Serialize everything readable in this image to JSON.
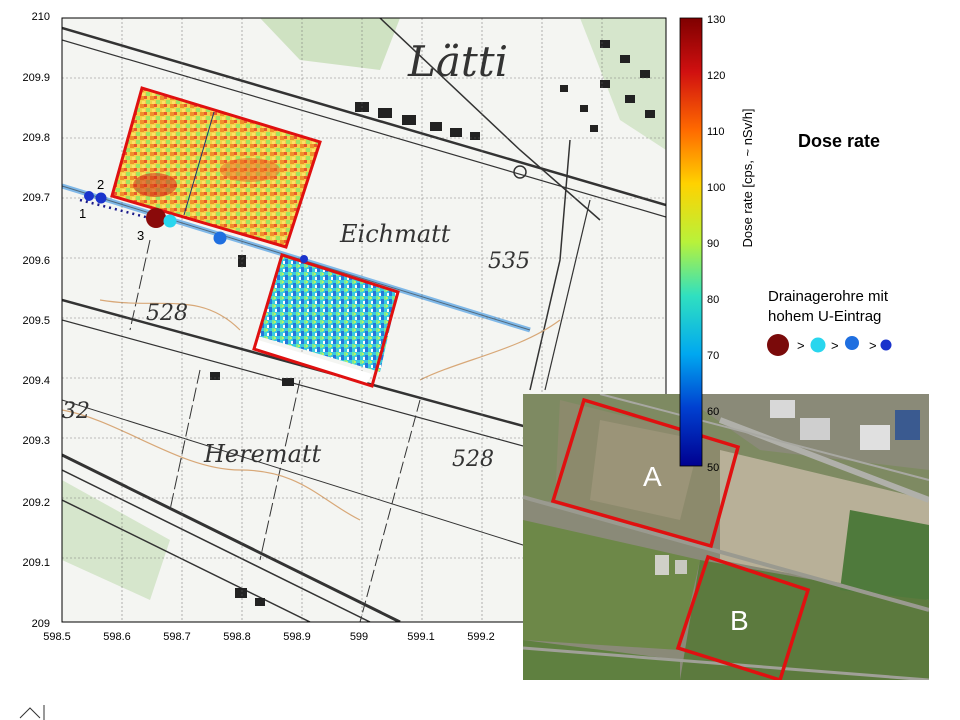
{
  "title": "Dose rate",
  "colorbar": {
    "label": "Dose rate [cps, ~ nSv/h]",
    "ticks": [
      "130",
      "120",
      "110",
      "100",
      "90",
      "80",
      "70",
      "60",
      "50"
    ]
  },
  "axes": {
    "y_ticks": [
      "210",
      "209.9",
      "209.8",
      "209.7",
      "209.6",
      "209.5",
      "209.4",
      "209.3",
      "209.2",
      "209.1",
      "209"
    ],
    "x_ticks": [
      "598.5",
      "598.6",
      "598.7",
      "598.8",
      "598.9",
      "599",
      "599.1",
      "599.2"
    ]
  },
  "map_labels": {
    "latti": "Lätti",
    "eichmatt": "Eichmatt",
    "herematt": "Herematt",
    "e535": "535",
    "e528a": "528",
    "e528b": "528",
    "e32": "32"
  },
  "points": {
    "p1": "1",
    "p2": "2",
    "p3": "3"
  },
  "legend": {
    "title": "Drainagerohre mit hohem U-Eintrag",
    "sep1": ">",
    "sep2": ">",
    "sep3": ">",
    "colors": [
      "#7a0a0a",
      "#29d6ee",
      "#1f6fe0",
      "#1a33cc"
    ]
  },
  "inset": {
    "label_a": "A",
    "label_b": "B"
  }
}
